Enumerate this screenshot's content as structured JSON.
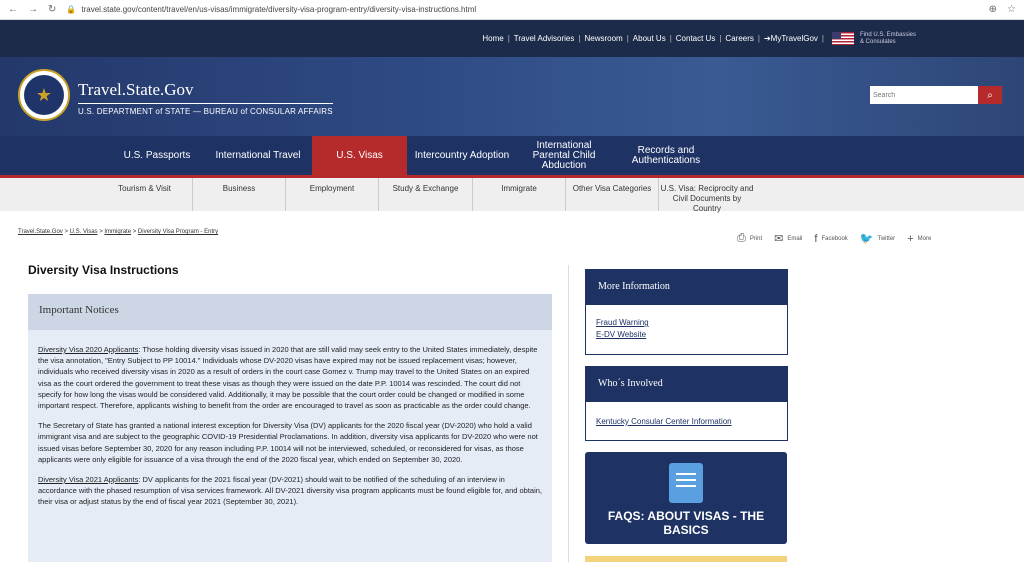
{
  "browser": {
    "url": "travel.state.gov/content/travel/en/us-visas/immigrate/diversity-visa-program-entry/diversity-visa-instructions.html"
  },
  "utility": {
    "links": [
      "Home",
      "Travel Advisories",
      "Newsroom",
      "About Us",
      "Contact Us",
      "Careers",
      "MyTravelGov"
    ],
    "embassy": "Find U.S. Embassies & Consulates"
  },
  "header": {
    "title": "Travel.State.Gov",
    "subtitle": "U.S. DEPARTMENT of STATE — BUREAU of CONSULAR AFFAIRS",
    "search_placeholder": "Search"
  },
  "mainnav": [
    "U.S. Passports",
    "International Travel",
    "U.S. Visas",
    "Intercountry Adoption",
    "International Parental Child Abduction",
    "Records and Authentications"
  ],
  "subnav": [
    "Tourism & Visit",
    "Business",
    "Employment",
    "Study & Exchange",
    "Immigrate",
    "Other Visa Categories",
    "U.S. Visa: Reciprocity and Civil Documents by Country"
  ],
  "breadcrumb": [
    "Travel.State.Gov",
    "U.S. Visas",
    "Immigrate",
    "Diversity Visa Program - Entry"
  ],
  "share": [
    "Print",
    "Email",
    "Facebook",
    "Twitter",
    "More"
  ],
  "main": {
    "title": "Diversity Visa Instructions",
    "notices_title": "Important Notices",
    "p1_link": "Diversity Visa 2020 Applicants",
    "p1_text": ":  Those holding diversity visas issued in 2020 that are still valid may seek entry to the United States immediately, despite the visa annotation, \"Entry Subject to PP 10014.\"  Individuals whose DV-2020 visas have expired may not be issued replacement visas; however, individuals who received diversity visas in 2020 as a result of orders in the court case Gomez v. Trump may travel to the United States on an expired visa as the court ordered the government to treat these visas as though they were issued on the date P.P. 10014 was rescinded. The court  did not specify for how long the visas would be considered valid.   Additionally, it may be possible that the court order could be changed or modified in some important respect.  Therefore, applicants wishing to benefit from the order are encouraged to travel as soon as practicable as the order could change.",
    "p2_text": "The Secretary of State has granted a national interest exception for Diversity Visa (DV) applicants for the 2020 fiscal year (DV-2020) who hold a valid immigrant visa and are subject to the geographic COVID-19 Presidential Proclamations.  In addition, diversity visa applicants for DV-2020 who were not issued visas before September 30, 2020 for any reason including P.P. 10014 will not be interviewed, scheduled, or reconsidered for visas, as those applicants were only eligible for issuance of a visa through the end of the 2020 fiscal year, which ended on September 30, 2020.",
    "p3_link": "Diversity Visa 2021 Applicants",
    "p3_text": ":  DV applicants for the 2021 fiscal year (DV-2021) should wait to be notified of the scheduling of an interview in accordance with the phased resumption of visa services framework.  All DV-2021 diversity visa program applicants must be found eligible for, and obtain, their visa or adjust status by the end of fiscal year 2021 (September 30, 2021)."
  },
  "sidebar": {
    "more_info_title": "More Information",
    "more_info_links": [
      "Fraud Warning",
      "E-DV Website"
    ],
    "involved_title": "Who´s Involved",
    "involved_links": [
      "Kentucky Consular Center Information"
    ],
    "faq_label": "FAQS: ABOUT VISAS - THE BASICS"
  }
}
